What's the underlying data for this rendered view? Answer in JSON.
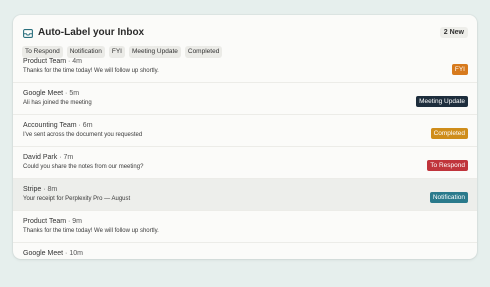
{
  "header": {
    "title": "Auto-Label your Inbox",
    "badge": "2 New"
  },
  "filters": [
    "To Respond",
    "Notification",
    "FYI",
    "Meeting Update",
    "Completed"
  ],
  "label_colors": {
    "FYI": "#d77a1d",
    "Meeting Update": "#1d2d3c",
    "Completed": "#cf8d1a",
    "To Respond": "#c0343b",
    "Notification": "#2a7a8c"
  },
  "emails": [
    {
      "sender": "Product Team",
      "time": "· 4m",
      "preview": "Thanks for the time today! We will follow up shortly.",
      "label": "FYI"
    },
    {
      "sender": "Google Meet",
      "time": "· 5m",
      "preview": "Ali has joined the meeting",
      "label": "Meeting Update"
    },
    {
      "sender": "Accounting Team",
      "time": "· 6m",
      "preview": "I've sent across the document you requested",
      "label": "Completed"
    },
    {
      "sender": "David Park",
      "time": "· 7m",
      "preview": "Could you share the notes from our meeting?",
      "label": "To Respond"
    },
    {
      "sender": "Stripe",
      "time": "· 8m",
      "preview": "Your receipt for Perplexity Pro — August",
      "label": "Notification"
    },
    {
      "sender": "Product Team",
      "time": "· 9m",
      "preview": "Thanks for the time today! We will follow up shortly.",
      "label": ""
    },
    {
      "sender": "Google Meet",
      "time": "· 10m",
      "preview": "",
      "label": ""
    }
  ]
}
